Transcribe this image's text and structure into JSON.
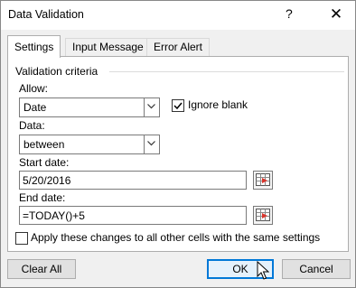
{
  "window": {
    "title": "Data Validation",
    "help_symbol": "?",
    "close_symbol": "✕"
  },
  "tabs": [
    {
      "label": "Settings",
      "active": true
    },
    {
      "label": "Input Message",
      "active": false
    },
    {
      "label": "Error Alert",
      "active": false
    }
  ],
  "criteria": {
    "group_title": "Validation criteria",
    "allow_label": "Allow:",
    "allow_value": "Date",
    "ignore_blank_label": "Ignore blank",
    "ignore_blank_checked": true,
    "data_label": "Data:",
    "data_value": "between",
    "start_label": "Start date:",
    "start_value": "5/20/2016",
    "end_label": "End date:",
    "end_value": "=TODAY()+5"
  },
  "apply_all": {
    "label": "Apply these changes to all other cells with the same settings",
    "checked": false
  },
  "buttons": {
    "clear_all": "Clear All",
    "ok": "OK",
    "cancel": "Cancel"
  },
  "icons": {
    "dropdown": "chevron-down-icon",
    "range_picker": "range-selector-icon",
    "checkmark": "checkmark-icon",
    "cursor": "mouse-pointer-icon"
  },
  "colors": {
    "accent": "#0078d7",
    "picker_red": "#d9342b"
  }
}
